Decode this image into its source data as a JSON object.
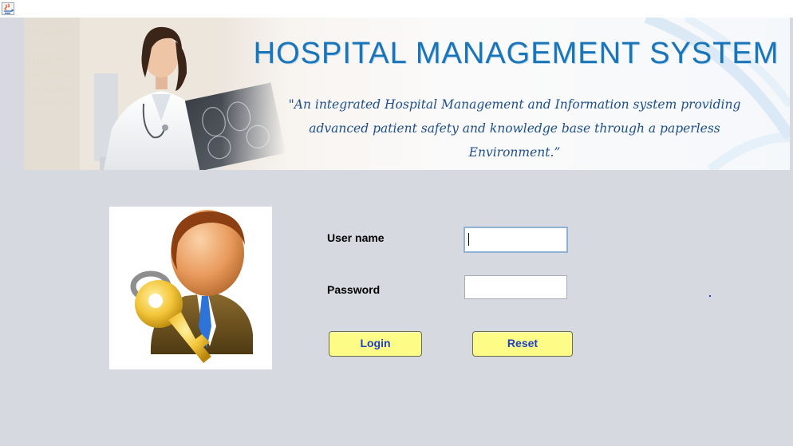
{
  "window": {
    "icon": "java-app-icon"
  },
  "banner": {
    "title": "HOSPITAL MANAGEMENT SYSTEM",
    "quote_line1": "\"An integrated Hospital Management and Information system providing",
    "quote_line2": "advanced patient safety and knowledge base through a paperless",
    "quote_line3": "Environment.”",
    "image": "doctor-with-xray-photo"
  },
  "login_form": {
    "user_icon": "user-with-key-icon",
    "username_label": "User name",
    "username_value": "",
    "password_label": "Password",
    "password_value": "",
    "login_button": "Login",
    "reset_button": "Reset"
  },
  "colors": {
    "title": "#1a74b8",
    "quote": "#1c4f8c",
    "button_bg": "#fdfc86",
    "button_text": "#1f3fc4",
    "background": "#d6d9e0"
  }
}
